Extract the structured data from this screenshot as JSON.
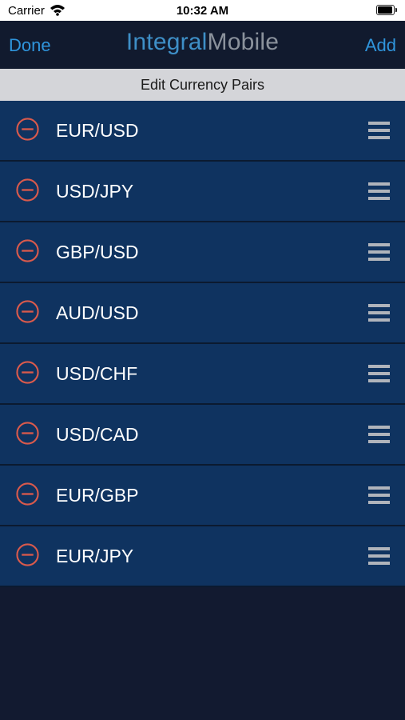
{
  "status_bar": {
    "carrier": "Carrier",
    "time": "10:32 AM",
    "wifi_icon": "wifi-icon",
    "battery_icon": "battery-icon"
  },
  "nav": {
    "done_label": "Done",
    "add_label": "Add",
    "logo_part1": "Integral",
    "logo_part2": "Mobile"
  },
  "section": {
    "title": "Edit Currency Pairs"
  },
  "pairs": [
    {
      "label": "EUR/USD"
    },
    {
      "label": "USD/JPY"
    },
    {
      "label": "GBP/USD"
    },
    {
      "label": "AUD/USD"
    },
    {
      "label": "USD/CHF"
    },
    {
      "label": "USD/CAD"
    },
    {
      "label": "EUR/GBP"
    },
    {
      "label": "EUR/JPY"
    }
  ],
  "icons": {
    "delete": "minus-circle-icon",
    "reorder": "reorder-handle-icon"
  },
  "colors": {
    "accent": "#2f95dc",
    "row_background": "#0f3360",
    "delete_red": "#d95a4c",
    "background": "#121a30"
  }
}
